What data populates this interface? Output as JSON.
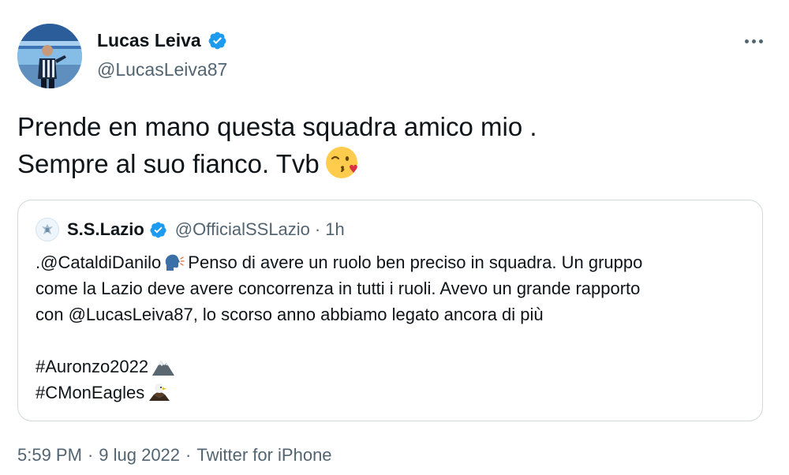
{
  "tweet": {
    "author": {
      "name": "Lucas Leiva",
      "handle": "@LucasLeiva87",
      "verified": true,
      "avatar_icon": "profile-photo-stadium"
    },
    "more_icon": "more-options-icon",
    "text_lines": [
      "Prende en mano questa squadra amico mio .",
      "Sempre al suo fianco. Tvb"
    ],
    "text_emoji": "face-blowing-kiss",
    "quoted": {
      "author_name": "S.S.Lazio",
      "handle": "@OfficialSSLazio",
      "separator": "·",
      "time": "1h",
      "verified": true,
      "logo_icon": "lazio-eagle-crest",
      "lines": {
        "l1_mention": ".@CataldiDanilo",
        "l1_rest": "Penso di avere un ruolo ben preciso in squadra. Un gruppo",
        "l2": "come la Lazio deve avere concorrenza in tutti i ruoli. Avevo un grande rapporto",
        "l3_mention": "con @LucasLeiva87",
        "l3_rest": ", lo scorso anno abbiamo legato ancora di più",
        "hashtag1": "#Auronzo2022",
        "hashtag2": "#CMonEagles"
      },
      "emojis": [
        "speaking-head",
        "snow-capped-mountain",
        "eagle"
      ]
    },
    "footer": {
      "time": "5:59 PM",
      "separator": "·",
      "date": "9 lug 2022",
      "source": "Twitter for iPhone"
    }
  },
  "colors": {
    "text": "#0f1419",
    "secondary": "#536471",
    "verified_blue": "#1d9bf0",
    "border": "#cfd9de"
  }
}
